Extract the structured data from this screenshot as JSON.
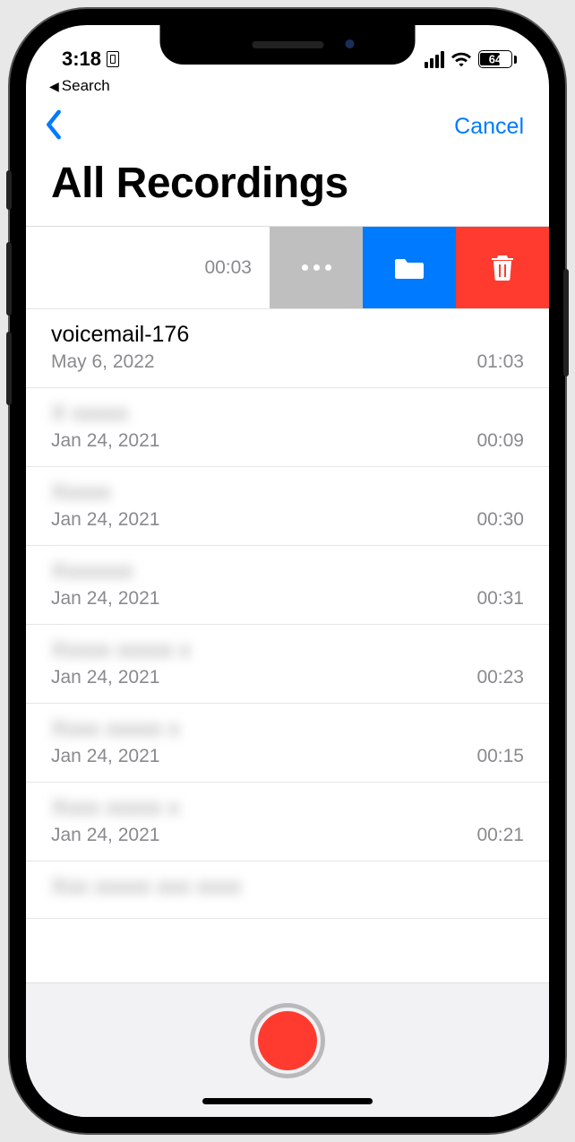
{
  "status": {
    "time": "3:18",
    "battery_level": "64",
    "back_to_label": "Search"
  },
  "nav": {
    "cancel_label": "Cancel"
  },
  "page": {
    "title": "All Recordings"
  },
  "swiped": {
    "duration": "00:03"
  },
  "recordings": [
    {
      "title": "voicemail-176",
      "date": "May 6, 2022",
      "duration": "01:03",
      "blurred": false
    },
    {
      "title": "X xxxxx",
      "date": "Jan 24, 2021",
      "duration": "00:09",
      "blurred": true
    },
    {
      "title": "Xxxxx",
      "date": "Jan 24, 2021",
      "duration": "00:30",
      "blurred": true
    },
    {
      "title": "Xxxxxxx",
      "date": "Jan 24, 2021",
      "duration": "00:31",
      "blurred": true
    },
    {
      "title": "Xxxxx xxxxx x",
      "date": "Jan 24, 2021",
      "duration": "00:23",
      "blurred": true
    },
    {
      "title": "Xxxx xxxxx x",
      "date": "Jan 24, 2021",
      "duration": "00:15",
      "blurred": true
    },
    {
      "title": "Xxxx xxxxx x",
      "date": "Jan 24, 2021",
      "duration": "00:21",
      "blurred": true
    },
    {
      "title": "Xxx xxxxx xxx xxxx",
      "date": "",
      "duration": "",
      "blurred": true
    }
  ],
  "colors": {
    "accent_blue": "#007aff",
    "destructive_red": "#ff3b30",
    "swipe_gray": "#bfbfbf"
  }
}
